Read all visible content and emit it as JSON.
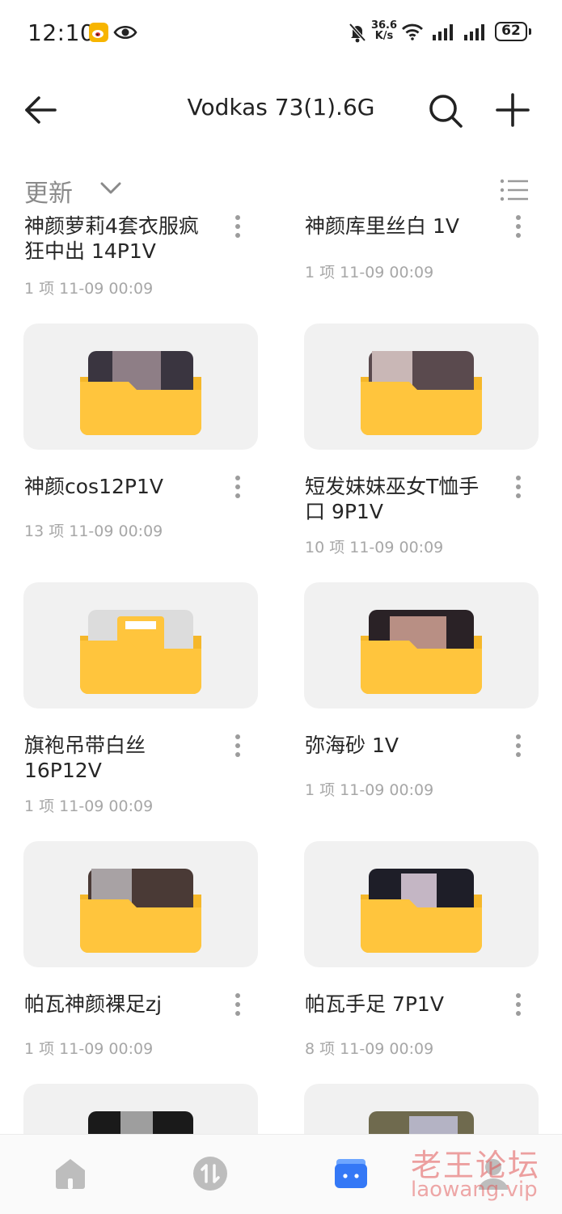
{
  "status_bar": {
    "time": "12:10",
    "net_speed_value": "36.6",
    "net_speed_unit": "K/s",
    "battery": "62"
  },
  "header": {
    "title": "Vodkas 73(1).6G"
  },
  "sort": {
    "label": "更新"
  },
  "items": [
    {
      "name": "神颜萝莉4套衣服疯狂中出 14P1V",
      "meta": "1 项  11-09 00:09"
    },
    {
      "name": "神颜库里丝白 1V",
      "meta": "1 项  11-09 00:09"
    },
    {
      "name": "神颜cos12P1V",
      "meta": "13 项  11-09 00:09"
    },
    {
      "name": "短发妹妹巫女T恤手口 9P1V",
      "meta": "10 项  11-09 00:09"
    },
    {
      "name": "旗袍吊带白丝16P12V",
      "meta": "1 项  11-09 00:09"
    },
    {
      "name": "弥海砂 1V",
      "meta": "1 项  11-09 00:09"
    },
    {
      "name": "帕瓦神颜裸足zj",
      "meta": "1 项  11-09 00:09"
    },
    {
      "name": "帕瓦手足 7P1V",
      "meta": "8 项  11-09 00:09"
    }
  ],
  "watermark": {
    "cn": "老王论坛",
    "en": "laowang.vip"
  },
  "colors": {
    "folder": "#ffc53d",
    "folder_back": "#f5b72a",
    "accent": "#3478f6",
    "card_bg": "#f1f1f1"
  },
  "icons": [
    "weibo-icon",
    "eye-icon",
    "mute-icon",
    "wifi-icon",
    "signal-icon",
    "back-icon",
    "search-icon",
    "add-icon",
    "chevron-down-icon",
    "list-view-icon",
    "more-icon",
    "folder-icon",
    "home-icon",
    "transfer-icon",
    "files-icon",
    "profile-icon"
  ]
}
